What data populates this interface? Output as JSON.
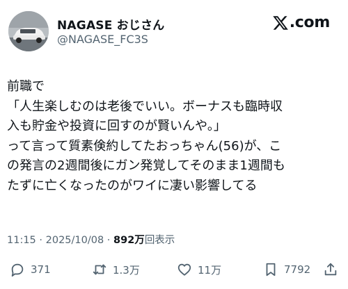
{
  "user": {
    "display_name": "NAGASE おじさん",
    "handle": "@NAGASE_FC3S",
    "avatar_icon": "car-photo-avatar"
  },
  "brand": {
    "icon": "x-logo-icon",
    "label": ".com"
  },
  "tweet": {
    "lines": [
      "前職で",
      "「人生楽しむのは老後でいい。ボーナスも臨時収",
      "入も貯金や投資に回すのが賢いんや。」",
      "って言って質素倹約してたおっちゃん(56)が、こ",
      "の発言の2週間後にガン発覚してそのまま1週間も",
      "たずに亡くなったのがワイに凄い影響してる"
    ]
  },
  "meta": {
    "time": "11:15",
    "separator": " · ",
    "date": "2025/10/08",
    "views_count": "892万",
    "views_label": "回表示"
  },
  "actions": {
    "reply_count": "371",
    "retweet_count": "1.3万",
    "like_count": "11万",
    "bookmark_count": "7792"
  },
  "colors": {
    "text": "#0f1419",
    "secondary": "#536471",
    "background": "#ffffff"
  }
}
